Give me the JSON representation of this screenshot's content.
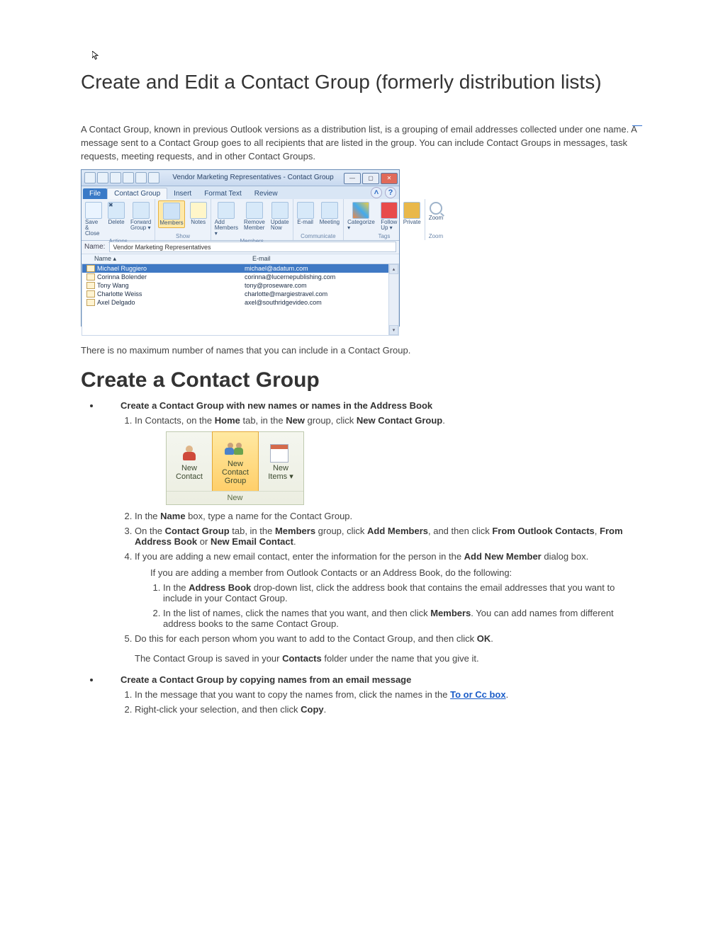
{
  "title": "Create and Edit a Contact Group (formerly distribution lists)",
  "dash": "—",
  "intro": "A Contact Group, known in previous Outlook versions as a distribution list, is a grouping of email addresses collected under one name. A message sent to a Contact Group goes to all recipients that are listed in the group. You can include Contact Groups in messages, task requests, meeting requests, and in other Contact Groups.",
  "win1": {
    "title": "Vendor Marketing Representatives - Contact Group",
    "tabs": [
      "File",
      "Contact Group",
      "Insert",
      "Format Text",
      "Review"
    ],
    "groups": {
      "actions": {
        "save": "Save &\nClose",
        "delete": "Delete",
        "forward": "Forward\nGroup ▾",
        "label": "Actions"
      },
      "show": {
        "members": "Members",
        "notes": "Notes",
        "label": "Show"
      },
      "members": {
        "add": "Add\nMembers ▾",
        "remove": "Remove\nMember",
        "update": "Update\nNow",
        "label": "Members"
      },
      "communicate": {
        "email": "E-mail",
        "meeting": "Meeting",
        "label": "Communicate"
      },
      "tags": {
        "categorize": "Categorize\n▾",
        "followup": "Follow\nUp ▾",
        "private": "Private",
        "label": "Tags"
      },
      "zoom": {
        "zoom": "Zoom",
        "label": "Zoom"
      }
    },
    "name_label": "Name:",
    "name_value": "Vendor Marketing Representatives",
    "col_name": "Name   ▴",
    "col_email": "E-mail",
    "rows": [
      {
        "name": "Michael Ruggiero",
        "email": "michael@adatum.com",
        "sel": true
      },
      {
        "name": "Corinna Bolender",
        "email": "corinna@lucernepublishing.com"
      },
      {
        "name": "Tony Wang",
        "email": "tony@proseware.com"
      },
      {
        "name": "Charlotte Weiss",
        "email": "charlotte@margiestravel.com"
      },
      {
        "name": "Axel Delgado",
        "email": "axel@southridgevideo.com"
      }
    ]
  },
  "after_img1": "There is no maximum number of names that you can include in a Contact Group.",
  "h2": "Create a Contact Group",
  "bullet1": "Create a Contact Group with new names or names in the Address Book",
  "step1_a": "In Contacts, on the ",
  "step1_b": "Home",
  "step1_c": " tab, in the ",
  "step1_d": "New",
  "step1_e": " group, click ",
  "step1_f": "New Contact Group",
  "step1_g": ".",
  "win2": {
    "new_contact": "New\nContact",
    "new_group": "New Contact\nGroup",
    "new_items": "New\nItems ▾",
    "footer": "New"
  },
  "step2_a": "In the ",
  "step2_b": "Name",
  "step2_c": " box, type a name for the Contact Group.",
  "step3_a": "On the ",
  "step3_b": "Contact Group",
  "step3_c": " tab, in the ",
  "step3_d": "Members",
  "step3_e": " group, click ",
  "step3_f": "Add Members",
  "step3_g": ", and then click ",
  "step3_h": "From Outlook Contacts",
  "step3_i": ", ",
  "step3_j": "From Address Book",
  "step3_k": " or ",
  "step3_l": "New Email Contact",
  "step3_m": ".",
  "step4_a": "If you are adding a new email contact, enter the information for the person in the ",
  "step4_b": "Add New Member",
  "step4_c": " dialog box.",
  "step4_sub": "If you are adding a member from Outlook Contacts or an Address Book, do the following:",
  "step4_1a": "In the ",
  "step4_1b": "Address Book",
  "step4_1c": " drop-down list, click the address book that contains the email addresses that you want to include in your Contact Group.",
  "step4_2a": "In the list of names, click the names that you want, and then click ",
  "step4_2b": "Members",
  "step4_2c": ". You can add names from different address books to the same Contact Group.",
  "step5_a": "Do this for each person whom you want to add to the Contact Group, and then click ",
  "step5_b": "OK",
  "step5_c": ".",
  "step5_sub_a": "The Contact Group is saved in your ",
  "step5_sub_b": "Contacts",
  "step5_sub_c": " folder under the name that you give it.",
  "bullet2": "Create a Contact Group by copying names from an email message",
  "b2_1a": "In the message that you want to copy the names from, click the names in the ",
  "b2_1link": "To or Cc box",
  "b2_1b": ".",
  "b2_2a": "Right-click your selection, and then click ",
  "b2_2b": "Copy",
  "b2_2c": "."
}
